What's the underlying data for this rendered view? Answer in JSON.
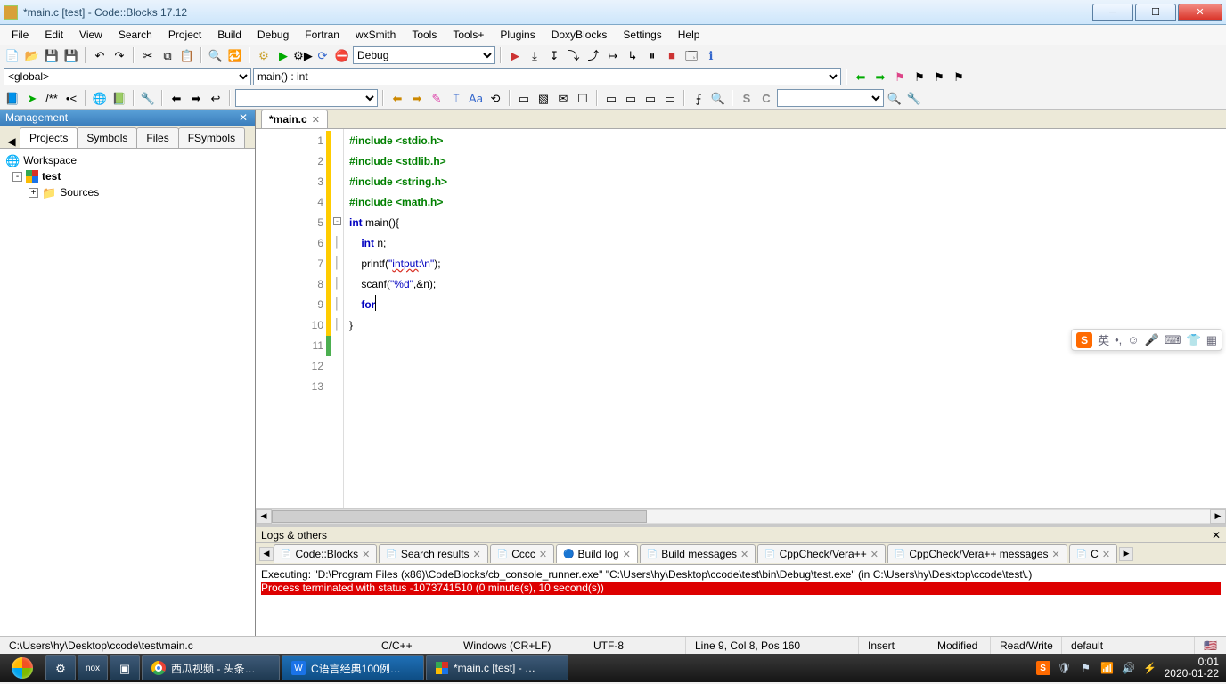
{
  "title": "*main.c [test] - Code::Blocks 17.12",
  "menus": [
    "File",
    "Edit",
    "View",
    "Search",
    "Project",
    "Build",
    "Debug",
    "Fortran",
    "wxSmith",
    "Tools",
    "Tools+",
    "Plugins",
    "DoxyBlocks",
    "Settings",
    "Help"
  ],
  "toolbar": {
    "build_target": "Debug",
    "scope": "<global>",
    "func": "main() : int"
  },
  "management": {
    "title": "Management",
    "tabs": [
      "Projects",
      "Symbols",
      "Files",
      "FSymbols"
    ],
    "tree": {
      "workspace": "Workspace",
      "project": "test",
      "sources": "Sources"
    }
  },
  "editor": {
    "tab_label": "*main.c",
    "lines": [
      {
        "n": 1,
        "seg": [
          {
            "t": "#include <stdio.h>",
            "c": "kw-green"
          }
        ]
      },
      {
        "n": 2,
        "seg": [
          {
            "t": "#include <stdlib.h>",
            "c": "kw-green"
          }
        ]
      },
      {
        "n": 3,
        "seg": [
          {
            "t": "#include <string.h>",
            "c": "kw-green"
          }
        ]
      },
      {
        "n": 4,
        "seg": [
          {
            "t": "#include <math.h>",
            "c": "kw-green"
          }
        ]
      },
      {
        "n": 5,
        "seg": [
          {
            "t": "int",
            "c": "kw-blue"
          },
          {
            "t": " main(){",
            "c": ""
          }
        ]
      },
      {
        "n": 6,
        "seg": [
          {
            "t": "    ",
            "c": ""
          },
          {
            "t": "int",
            "c": "kw-blue"
          },
          {
            "t": " n;",
            "c": ""
          }
        ]
      },
      {
        "n": 7,
        "seg": [
          {
            "t": "    printf(",
            "c": ""
          },
          {
            "t": "\"",
            "c": "str"
          },
          {
            "t": "intput",
            "c": "str squiggle"
          },
          {
            "t": ":\\n\"",
            "c": "str"
          },
          {
            "t": ");",
            "c": ""
          }
        ]
      },
      {
        "n": 8,
        "seg": [
          {
            "t": "    scanf(",
            "c": ""
          },
          {
            "t": "\"%d\"",
            "c": "str"
          },
          {
            "t": ",&n);",
            "c": ""
          }
        ]
      },
      {
        "n": 9,
        "seg": [
          {
            "t": "    ",
            "c": ""
          },
          {
            "t": "for",
            "c": "kw-blue"
          }
        ],
        "caret": true
      },
      {
        "n": 10,
        "seg": [
          {
            "t": "}",
            "c": ""
          }
        ]
      },
      {
        "n": 11,
        "seg": [
          {
            "t": "",
            "c": ""
          }
        ]
      },
      {
        "n": 12,
        "seg": [
          {
            "t": "",
            "c": ""
          }
        ]
      },
      {
        "n": 13,
        "seg": [
          {
            "t": "",
            "c": ""
          }
        ]
      }
    ]
  },
  "logs": {
    "header": "Logs & others",
    "tabs": [
      "Code::Blocks",
      "Search results",
      "Cccc",
      "Build log",
      "Build messages",
      "CppCheck/Vera++",
      "CppCheck/Vera++ messages",
      "C"
    ],
    "active_tab": "Build log",
    "body_lines": [
      {
        "t": "Executing: \"D:\\Program Files (x86)\\CodeBlocks/cb_console_runner.exe\" \"C:\\Users\\hy\\Desktop\\ccode\\test\\bin\\Debug\\test.exe\"  (in C:\\Users\\hy\\Desktop\\ccode\\test\\.)",
        "err": false
      },
      {
        "t": "Process terminated with status -1073741510 (0 minute(s), 10 second(s))",
        "err": true
      }
    ]
  },
  "status": {
    "path": "C:\\Users\\hy\\Desktop\\ccode\\test\\main.c",
    "lang": "C/C++",
    "eol": "Windows (CR+LF)",
    "enc": "UTF-8",
    "pos": "Line 9, Col 8, Pos 160",
    "ins": "Insert",
    "mod": "Modified",
    "rw": "Read/Write",
    "profile": "default"
  },
  "taskbar": {
    "items": [
      "西瓜视频 - 头条…",
      "C语言经典100例…",
      "*main.c [test] - …"
    ],
    "time": "0:01",
    "date": "2020-01-22"
  },
  "ime": {
    "label": "英"
  }
}
